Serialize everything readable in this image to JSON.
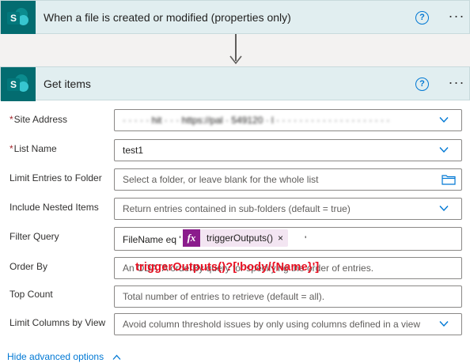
{
  "trigger": {
    "title": "When a file is created or modified (properties only)",
    "help_glyph": "?",
    "more_glyph": "···"
  },
  "action": {
    "title": "Get items",
    "help_glyph": "?",
    "more_glyph": "···",
    "logo_letter": "S"
  },
  "fields": {
    "site_address": {
      "label": "Site Address",
      "required_mark": "*",
      "value": "· · · · · hit · · · https://pal · 549120 · l · · · · · · · · · · · · · · · · · · · · "
    },
    "list_name": {
      "label": "List Name",
      "required_mark": "*",
      "value": "test1"
    },
    "limit_folder": {
      "label": "Limit Entries to Folder",
      "placeholder": "Select a folder, or leave blank for the whole list"
    },
    "nested_items": {
      "label": "Include Nested Items",
      "placeholder": "Return entries contained in sub-folders (default = true)"
    },
    "filter_query": {
      "label": "Filter Query",
      "prefix": "FileName eq '",
      "token_label": "triggerOutputs()",
      "token_fx": "fx",
      "token_remove": "×",
      "suffix": "'"
    },
    "order_by": {
      "label": "Order By",
      "placeholder": "An ODATA orderBy query for specifying the order of entries."
    },
    "top_count": {
      "label": "Top Count",
      "placeholder": "Total number of entries to retrieve (default = all)."
    },
    "limit_columns": {
      "label": "Limit Columns by View",
      "placeholder": "Avoid column threshold issues by only using columns defined in a view"
    }
  },
  "overlay_expression": "triggerOutputs()?['body/{Name}']",
  "advanced_link": "Hide advanced options",
  "colors": {
    "header_bg": "#e1eef0",
    "sharepoint_teal": "#036c70",
    "link_blue": "#0078d4",
    "token_purple": "#8b1c8c",
    "overlay_red": "#e81123"
  },
  "icons": [
    "sharepoint-logo-icon",
    "help-icon",
    "more-options-icon",
    "down-arrow-icon",
    "chevron-down-icon",
    "folder-icon",
    "fx-icon",
    "close-icon",
    "chevron-up-icon"
  ]
}
